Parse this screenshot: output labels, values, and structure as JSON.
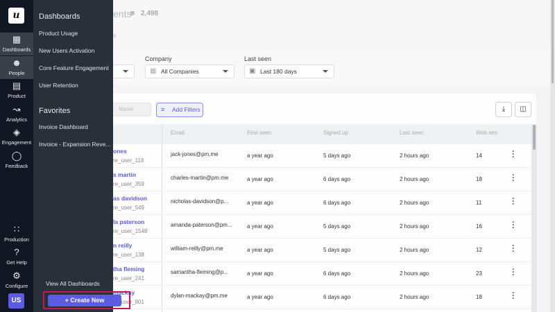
{
  "rail": {
    "logo": "u",
    "items": [
      {
        "label": "Dashboards",
        "icon": "grid-icon"
      },
      {
        "label": "People",
        "icon": "people-icon"
      },
      {
        "label": "Product",
        "icon": "product-icon"
      },
      {
        "label": "Analytics",
        "icon": "chart-line-icon"
      },
      {
        "label": "Engagement",
        "icon": "layers-icon"
      },
      {
        "label": "Feedback",
        "icon": "chat-icon"
      },
      {
        "label": "Production",
        "icon": "apps-grid-icon"
      },
      {
        "label": "Get Help",
        "icon": "help-icon"
      },
      {
        "label": "Configure",
        "icon": "gear-icon"
      }
    ],
    "avatar": "US"
  },
  "flyout": {
    "dashboards_title": "Dashboards",
    "dashboards": [
      "Product Usage",
      "New Users Activation",
      "Core Feature Engagement",
      "User Retention"
    ],
    "favorites_title": "Favorites",
    "favorites": [
      "Invoice Dashboard",
      "Invoice - Expansion Reve..."
    ],
    "view_all": "View All Dashboards",
    "create_new": "Create New"
  },
  "header": {
    "title_fragment": "ents",
    "count": "2,498",
    "tab_fragment": "s"
  },
  "filters": {
    "company_label": "Company",
    "company_value": "All Companies",
    "last_seen_label": "Last seen",
    "last_seen_value": "Last 180 days"
  },
  "toolbar": {
    "search_placeholder": "Name",
    "add_filters": "Add Filters"
  },
  "table": {
    "columns": [
      "Email",
      "First seen",
      "Signed up",
      "Last seen",
      "Web ses"
    ],
    "rows": [
      {
        "name": "ones",
        "id": "re_user_118",
        "email": "jack-jones@pm.me",
        "first_seen": "a year ago",
        "signed_up": "5 days ago",
        "last_seen": "2 hours ago",
        "web": "14"
      },
      {
        "name": "s martin",
        "id": "re_user_359",
        "email": "charles-martin@pm.me",
        "first_seen": "a year ago",
        "signed_up": "6 days ago",
        "last_seen": "2 hours ago",
        "web": "18"
      },
      {
        "name": "as davidson",
        "id": "re_user_549",
        "email": "nicholas-davidson@p...",
        "first_seen": "a year ago",
        "signed_up": "6 days ago",
        "last_seen": "2 hours ago",
        "web": "11"
      },
      {
        "name": "la paterson",
        "id": "re_user_1548",
        "email": "amanda-paterson@pm...",
        "first_seen": "a year ago",
        "signed_up": "5 days ago",
        "last_seen": "2 hours ago",
        "web": "16"
      },
      {
        "name": "n reilly",
        "id": "re_user_138",
        "email": "william-reilly@pm.me",
        "first_seen": "a year ago",
        "signed_up": "5 days ago",
        "last_seen": "2 hours ago",
        "web": "12"
      },
      {
        "name": "tha fleming",
        "id": "re_user_241",
        "email": "samantha-fleming@p...",
        "first_seen": "a year ago",
        "signed_up": "6 days ago",
        "last_seen": "2 hours ago",
        "web": "23"
      },
      {
        "name": "mackay",
        "id": "re_user_801",
        "email": "dylan-mackay@pm.me",
        "first_seen": "a year ago",
        "signed_up": "6 days ago",
        "last_seen": "2 hours ago",
        "web": "18"
      }
    ]
  },
  "colors": {
    "accent": "#5b5ce2",
    "rail": "#111823",
    "flyout": "#2a3038",
    "highlight": "#c2185b"
  }
}
